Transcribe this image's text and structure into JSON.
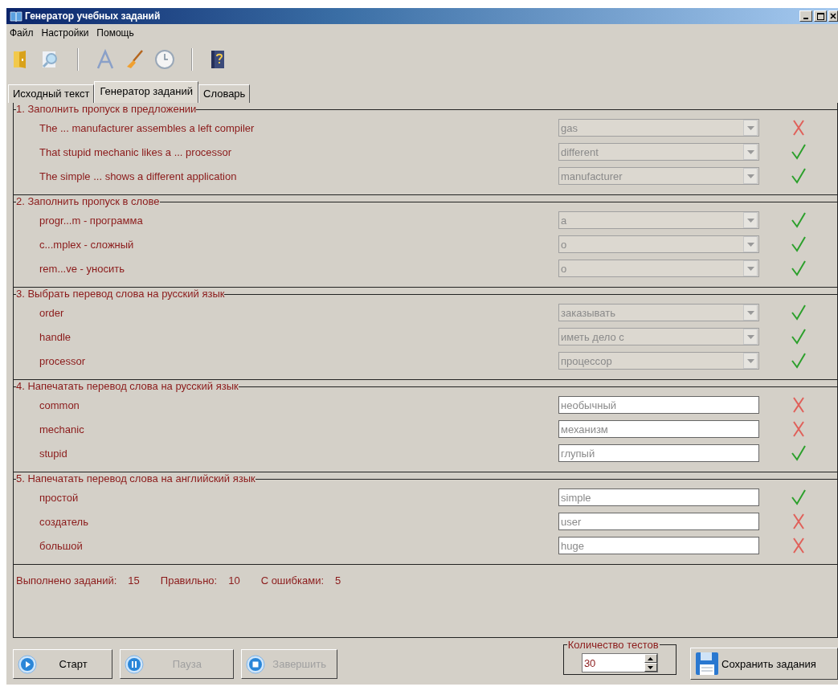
{
  "window": {
    "title": "Генератор учебных заданий"
  },
  "menu": [
    "Файл",
    "Настройки",
    "Помощь"
  ],
  "tabs": [
    {
      "label": "Исходный текст",
      "selected": false
    },
    {
      "label": "Генератор заданий",
      "selected": true
    },
    {
      "label": "Словарь",
      "selected": false
    }
  ],
  "sections": [
    {
      "title": "1. Заполнить пропуск в предложении",
      "kind": "combo",
      "items": [
        {
          "prompt": "The ... manufacturer assembles a left compiler",
          "value": "gas",
          "correct": false
        },
        {
          "prompt": "That stupid mechanic likes a ... processor",
          "value": "different",
          "correct": true
        },
        {
          "prompt": "The simple ... shows a different application",
          "value": "manufacturer",
          "correct": true
        }
      ]
    },
    {
      "title": "2. Заполнить пропуск в слове",
      "kind": "combo",
      "items": [
        {
          "prompt": "progr...m - программа",
          "value": "a",
          "correct": true
        },
        {
          "prompt": "c...mplex - сложный",
          "value": "o",
          "correct": true
        },
        {
          "prompt": "rem...ve - уносить",
          "value": "o",
          "correct": true
        }
      ]
    },
    {
      "title": "3. Выбрать перевод слова на русский язык",
      "kind": "combo",
      "items": [
        {
          "prompt": "order",
          "value": "заказывать",
          "correct": true
        },
        {
          "prompt": "handle",
          "value": "иметь дело с",
          "correct": true
        },
        {
          "prompt": "processor",
          "value": "процессор",
          "correct": true
        }
      ]
    },
    {
      "title": "4. Напечатать перевод слова на русский язык",
      "kind": "text",
      "items": [
        {
          "prompt": "common",
          "value": "необычный",
          "correct": false
        },
        {
          "prompt": "mechanic",
          "value": "механизм",
          "correct": false
        },
        {
          "prompt": "stupid",
          "value": "глупый",
          "correct": true
        }
      ]
    },
    {
      "title": "5. Напечатать перевод слова на английский язык",
      "kind": "text",
      "items": [
        {
          "prompt": "простой",
          "value": "simple",
          "correct": true
        },
        {
          "prompt": "создатель",
          "value": "user",
          "correct": false
        },
        {
          "prompt": "большой",
          "value": "huge",
          "correct": false
        }
      ]
    }
  ],
  "stats": [
    {
      "label": "Выполнено заданий:",
      "value": "15"
    },
    {
      "label": "Правильно:",
      "value": "10"
    },
    {
      "label": "С ошибками:",
      "value": "5"
    }
  ],
  "buttons": [
    {
      "label": "Старт",
      "kind": "play",
      "disabled": false
    },
    {
      "label": "Пауза",
      "kind": "pause",
      "disabled": true
    },
    {
      "label": "Завершить",
      "kind": "stop",
      "disabled": true
    }
  ],
  "test_count": {
    "label": "Количество тестов",
    "value": "30"
  },
  "save_button": {
    "label": "Сохранить задания"
  }
}
